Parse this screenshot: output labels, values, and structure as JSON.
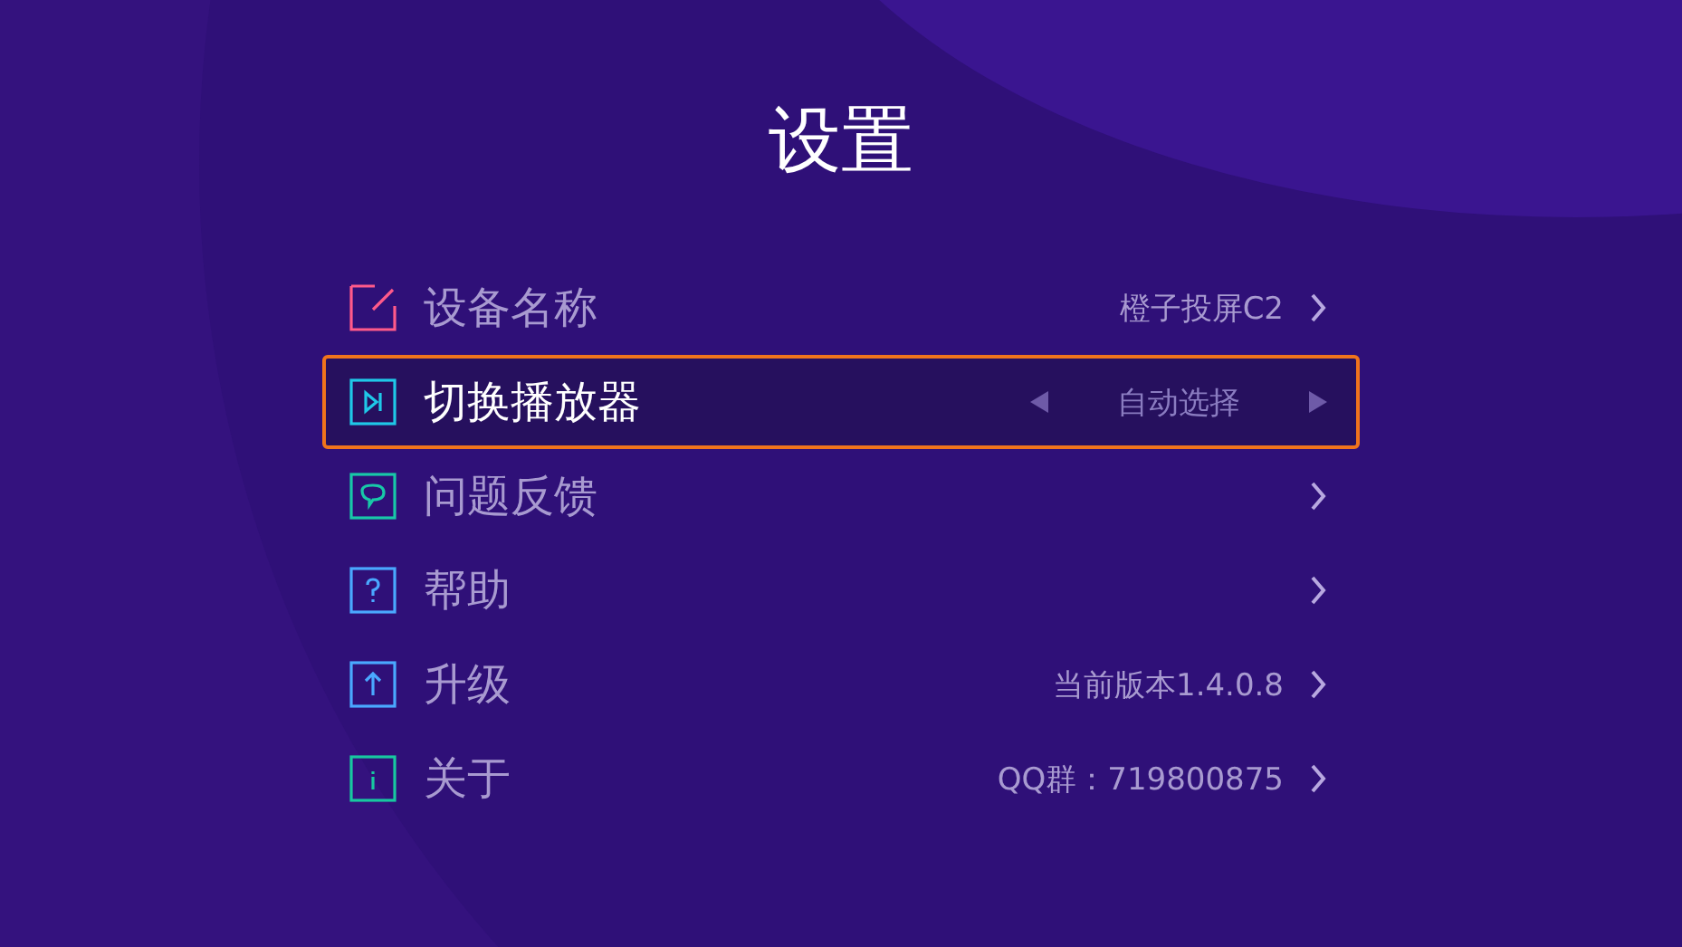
{
  "title": "设置",
  "items": [
    {
      "label": "设备名称",
      "kind": "link",
      "value": "橙子投屏C2",
      "selected": false
    },
    {
      "label": "切换播放器",
      "kind": "selector",
      "value": "自动选择",
      "selected": true
    },
    {
      "label": "问题反馈",
      "kind": "link",
      "selected": false
    },
    {
      "label": "帮助",
      "kind": "link",
      "selected": false
    },
    {
      "label": "升级",
      "kind": "link",
      "value": "当前版本1.4.0.8",
      "selected": false
    },
    {
      "label": "关于",
      "kind": "link",
      "value": "QQ群：719800875",
      "selected": false
    }
  ]
}
